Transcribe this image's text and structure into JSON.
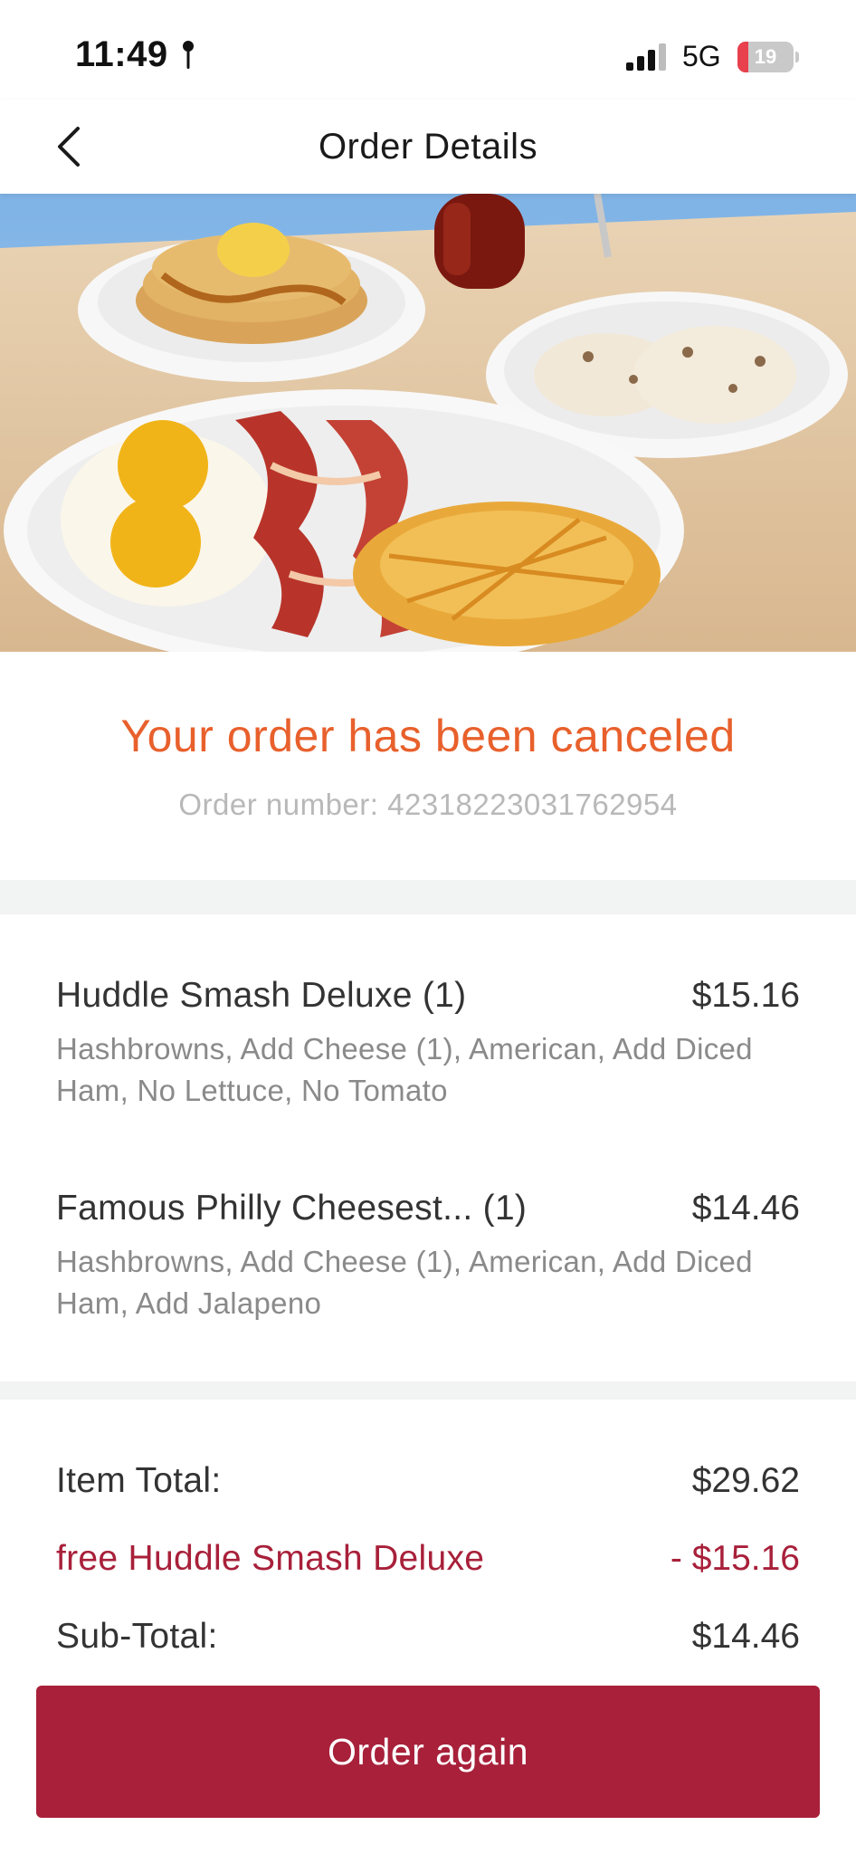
{
  "status_bar": {
    "time": "11:49",
    "network": "5G",
    "battery": "19",
    "battery_level": 0.19
  },
  "header": {
    "title": "Order Details"
  },
  "hero": {
    "image": "breakfast-platter-photo"
  },
  "order_status": {
    "message": "Your order has been canceled",
    "order_number": "Order number: 4231822303176295​4"
  },
  "items": [
    {
      "name": "Huddle Smash Deluxe",
      "qty": "(1)",
      "price": "$15.16",
      "mods": "Hashbrowns, Add Cheese (1), American, Add Diced Ham, No Lettuce, No Tomato"
    },
    {
      "name": "Famous Philly Cheesest...",
      "qty": "(1)",
      "price": "$14.46",
      "mods": "Hashbrowns, Add Cheese (1), American, Add Diced Ham, Add Jalapeno"
    }
  ],
  "totals": {
    "item_total_label": "Item Total:",
    "item_total_value": "$29.62",
    "discount_label": "free Huddle Smash Deluxe",
    "discount_value": "- $15.16",
    "subtotal_label": "Sub-Total:",
    "subtotal_value": "$14.46"
  },
  "actions": {
    "order_again": "Order again"
  },
  "colors": {
    "brand": "#a8203a",
    "cancel_text": "#e8602c",
    "muted_text": "#b8b8b8"
  }
}
